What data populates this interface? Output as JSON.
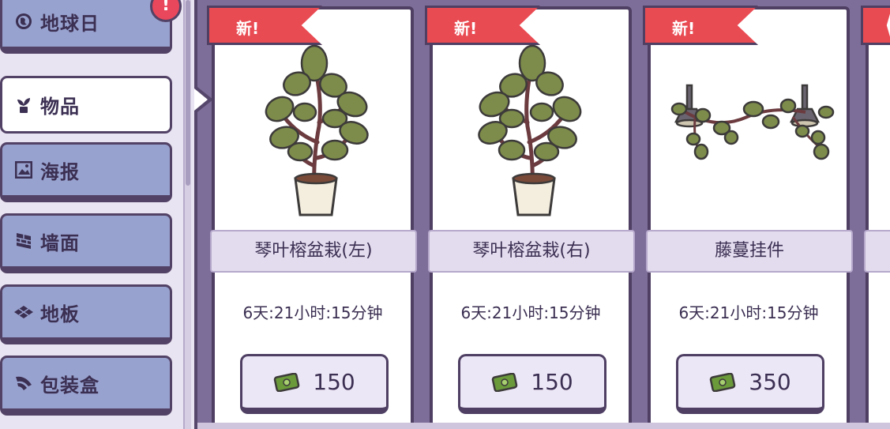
{
  "sidebar": {
    "alert_badge": "!",
    "tabs": [
      {
        "label": "地球日",
        "icon": "globe-icon"
      },
      {
        "label": "物品",
        "icon": "plant-icon"
      },
      {
        "label": "海报",
        "icon": "picture-icon"
      },
      {
        "label": "墙面",
        "icon": "brick-wall-icon"
      },
      {
        "label": "地板",
        "icon": "floor-tiles-icon"
      },
      {
        "label": "包装盒",
        "icon": "wrapping-icon"
      }
    ],
    "active_tab": "物品"
  },
  "shop": {
    "items": [
      {
        "badge": "新!",
        "name": "琴叶榕盆栽(左)",
        "timer": "6天:21小时:15分钟",
        "price": "150",
        "image": "fiddle-leaf-fig-plant"
      },
      {
        "badge": "新!",
        "name": "琴叶榕盆栽(右)",
        "timer": "6天:21小时:15分钟",
        "price": "150",
        "image": "fiddle-leaf-fig-plant"
      },
      {
        "badge": "新!",
        "name": "藤蔓挂件",
        "timer": "6天:21小时:15分钟",
        "price": "350",
        "image": "hanging-vine-lamps"
      }
    ]
  },
  "colors": {
    "background": "#7d6e99",
    "tab_inactive": "#98a2cf",
    "tab_active": "#ffffff",
    "outline": "#4e3f63",
    "ribbon": "#e94b53",
    "leaf": "#7d8c4a",
    "cash": "#6a9a3a"
  }
}
